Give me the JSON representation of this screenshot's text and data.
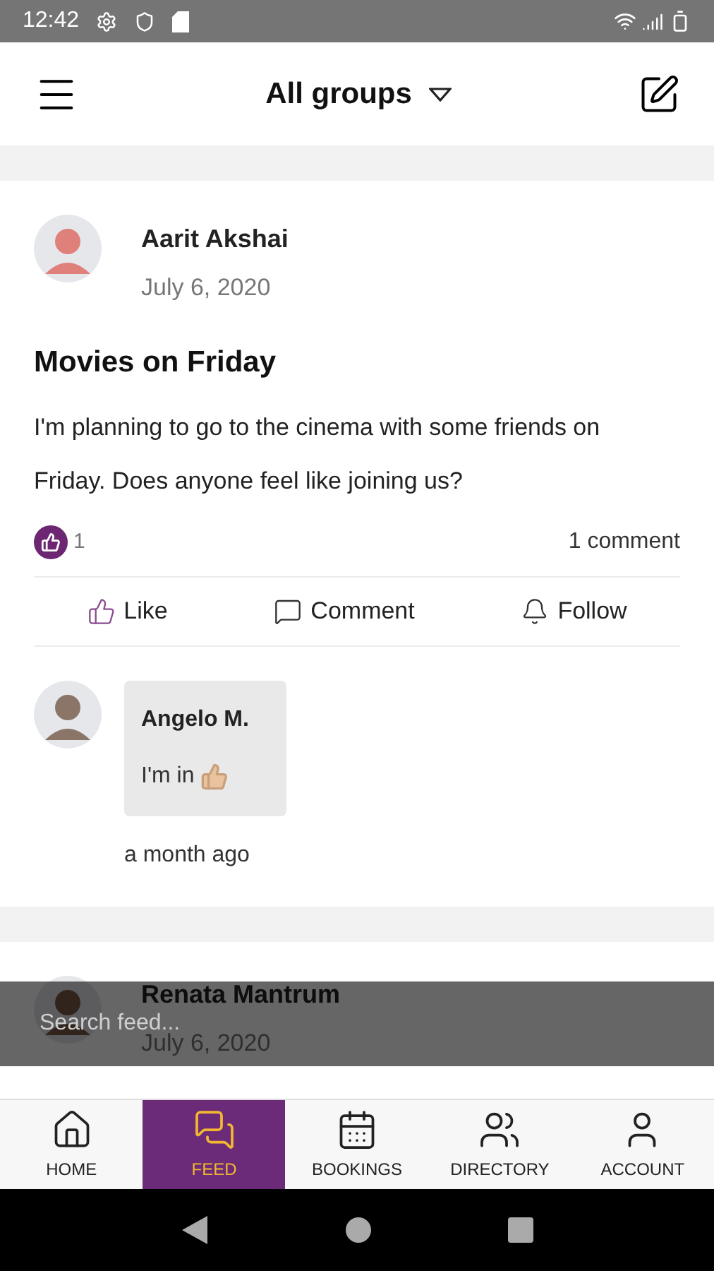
{
  "status_bar": {
    "time": "12:42"
  },
  "header": {
    "title": "All groups"
  },
  "posts": [
    {
      "author": "Aarit Akshai",
      "date": "July 6, 2020",
      "title": "Movies on Friday",
      "body": "I'm planning to go to the cinema with some friends on Friday. Does anyone feel like joining us?",
      "likes": "1",
      "comment_count": "1 comment",
      "actions": [
        "Like",
        "Comment",
        "Follow"
      ],
      "comments": [
        {
          "author": "Angelo M.",
          "text": "I'm in",
          "time": "a month ago"
        }
      ]
    },
    {
      "author": "Renata Mantrum",
      "date": "July 6, 2020"
    }
  ],
  "search": {
    "placeholder": "Search feed..."
  },
  "nav": [
    {
      "label": "HOME",
      "selected": false
    },
    {
      "label": "FEED",
      "selected": true
    },
    {
      "label": "BOOKINGS",
      "selected": false
    },
    {
      "label": "DIRECTORY",
      "selected": false
    },
    {
      "label": "ACCOUNT",
      "selected": false
    }
  ]
}
